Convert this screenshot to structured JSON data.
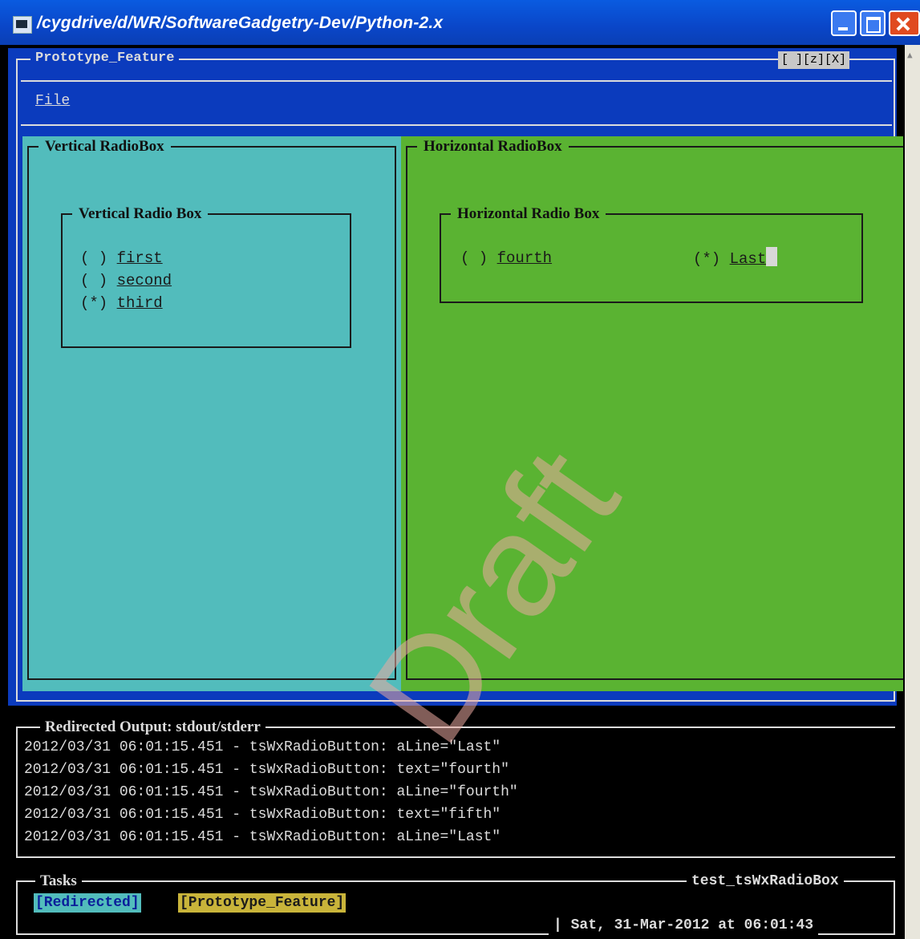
{
  "window": {
    "title": "/cygdrive/d/WR/SoftwareGadgetry-Dev/Python-2.x"
  },
  "frame": {
    "title": "Prototype_Feature",
    "box_buttons": "[ ][z][X]"
  },
  "menu": {
    "file_label": "File"
  },
  "vertical_panel": {
    "title": "Vertical RadioBox",
    "group_title": "Vertical Radio Box",
    "options": [
      {
        "mark": "( )",
        "label": "first",
        "selected": false
      },
      {
        "mark": "( )",
        "label": "second",
        "selected": false
      },
      {
        "mark": "(*)",
        "label": "third",
        "selected": true
      }
    ]
  },
  "horizontal_panel": {
    "title": "Horizontal RadioBox",
    "group_title": "Horizontal Radio Box",
    "options": [
      {
        "mark": "( )",
        "label": "fourth",
        "selected": false
      },
      {
        "mark": "(*)",
        "label": "Last",
        "selected": true
      }
    ]
  },
  "redirect": {
    "title": "Redirected Output: stdout/stderr",
    "lines": [
      "2012/03/31 06:01:15.451 - tsWxRadioButton: aLine=\"Last\"",
      "2012/03/31 06:01:15.451 - tsWxRadioButton: text=\"fourth\"",
      "2012/03/31 06:01:15.451 - tsWxRadioButton: aLine=\"fourth\"",
      "2012/03/31 06:01:15.451 - tsWxRadioButton: text=\"fifth\"",
      "2012/03/31 06:01:15.451 - tsWxRadioButton: aLine=\"Last\""
    ]
  },
  "tasks": {
    "title": "Tasks",
    "app_name": "test_tsWxRadioBox",
    "buttons": [
      "[Redirected]",
      "[Prototype_Feature]"
    ],
    "clock": "| Sat, 31-Mar-2012 at 06:01:43"
  },
  "watermark": "Draft",
  "colors": {
    "cyan": "#52bcbc",
    "green": "#5ab332",
    "blue": "#0b3bbd",
    "yellow": "#c9b43a"
  }
}
